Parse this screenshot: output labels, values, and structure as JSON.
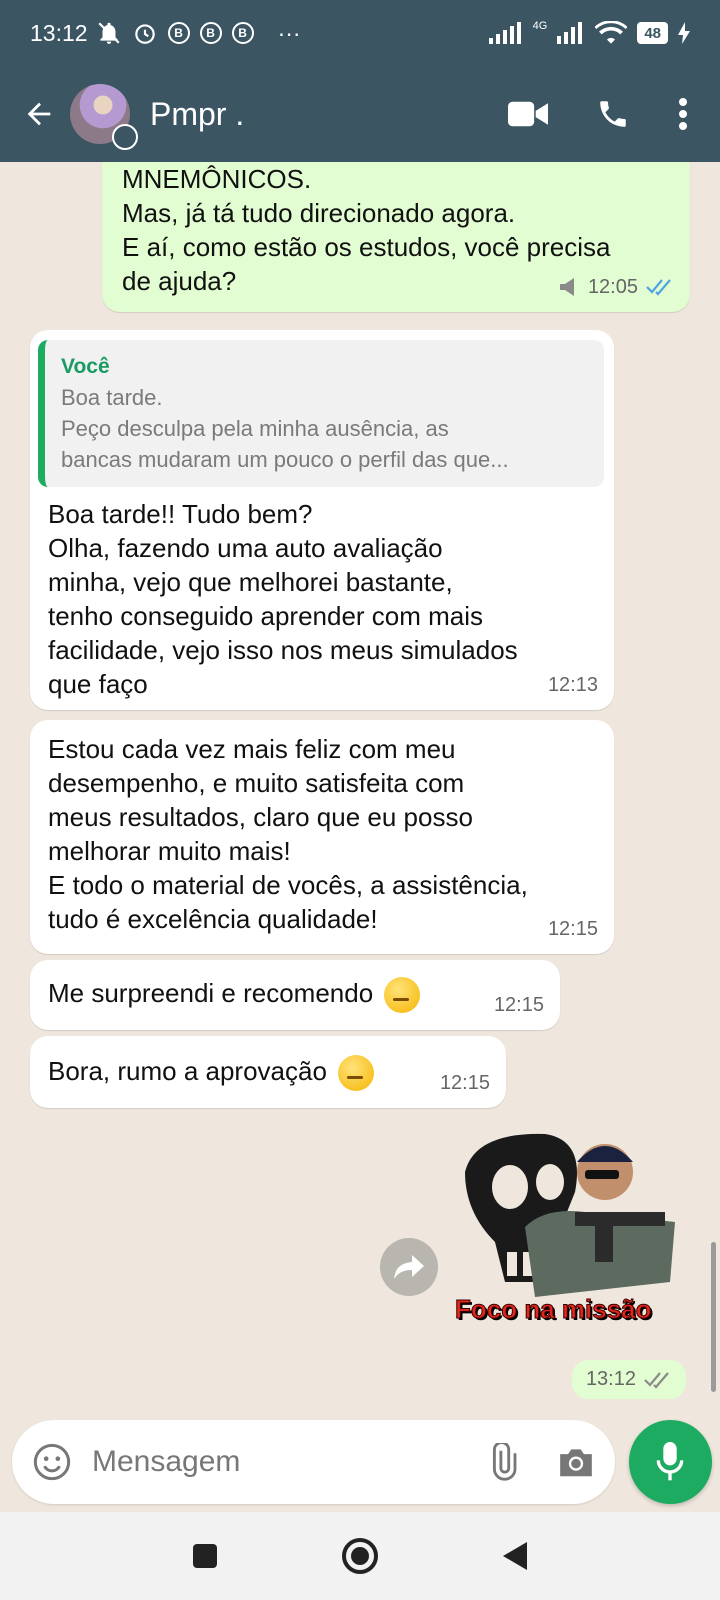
{
  "status_bar": {
    "time": "13:12",
    "notif_badges": [
      "B",
      "B",
      "B"
    ],
    "more": "···",
    "network": "4G",
    "battery": "48"
  },
  "header": {
    "contact_name": "Pmpr ."
  },
  "messages": [
    {
      "direction": "out",
      "text": "MNEMÔNICOS.\nMas, já tá tudo direcionado agora.\nE aí, como estão os estudos, você precisa\nde ajuda?",
      "time": "12:05"
    },
    {
      "direction": "in",
      "quote_author": "Você",
      "quote_text": "Boa tarde.\nPeço desculpa pela minha ausência, as\nbancas mudaram um pouco o perfil das que...",
      "text": "Boa tarde!! Tudo bem?\nOlha, fazendo uma auto avaliação\nminha, vejo que melhorei bastante,\ntenho conseguido aprender com mais\nfacilidade, vejo isso nos meus simulados\nque faço",
      "time": "12:13"
    },
    {
      "direction": "in",
      "text": "Estou cada vez mais feliz com meu\ndesempenho, e muito satisfeita com\nmeus resultados, claro que eu posso\nmelhorar muito mais!\nE todo o material de vocês, a assistência,\ntudo é excelência qualidade!",
      "time": "12:15"
    },
    {
      "direction": "in",
      "text": "Me surpreendi e recomendo",
      "time": "12:15"
    },
    {
      "direction": "in",
      "text": "Bora, rumo a aprovação",
      "time": "12:15"
    }
  ],
  "sticker": {
    "caption": "Foco na missão",
    "time": "13:12"
  },
  "composer": {
    "placeholder": "Mensagem"
  },
  "colors": {
    "header_bg": "#3b5563",
    "chat_bg": "#efe7dd",
    "out_bubble": "#e2fdd2",
    "in_bubble": "#ffffff",
    "accent_green": "#1daa61",
    "read_tick_blue": "#4fa3e3"
  }
}
